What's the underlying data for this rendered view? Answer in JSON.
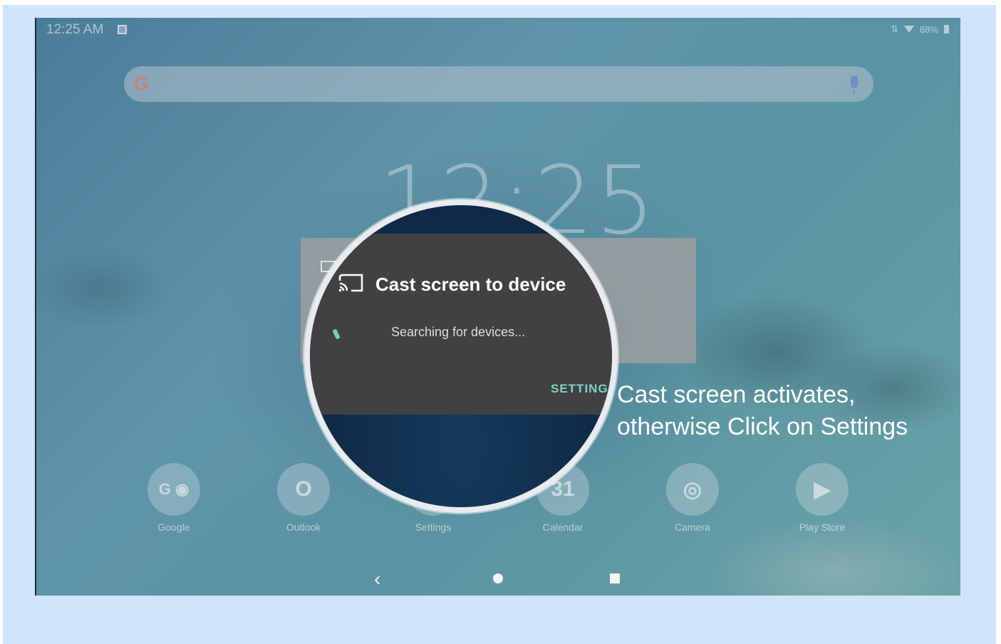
{
  "status_bar": {
    "time": "12:25 AM",
    "battery": "88%"
  },
  "home": {
    "clock": "12:25"
  },
  "apps": [
    {
      "label": "Google",
      "icon": "google-folder-icon"
    },
    {
      "label": "Outlook",
      "icon": "outlook-icon"
    },
    {
      "label": "Settings",
      "icon": "settings-icon"
    },
    {
      "label": "Calendar",
      "icon": "calendar-icon",
      "glyph": "31"
    },
    {
      "label": "Camera",
      "icon": "camera-icon"
    },
    {
      "label": "Play Store",
      "icon": "play-store-icon"
    }
  ],
  "cast_dialog": {
    "title": "Cast screen to device",
    "status": "Searching for devices...",
    "settings_label": "SETTINGS"
  },
  "caption": {
    "line1": "Cast screen activates,",
    "line2": "otherwise Click on Settings"
  },
  "colors": {
    "accent": "#7fd3c4",
    "dialog_bg": "#414141",
    "frame_bg": "#cfe4fa"
  }
}
